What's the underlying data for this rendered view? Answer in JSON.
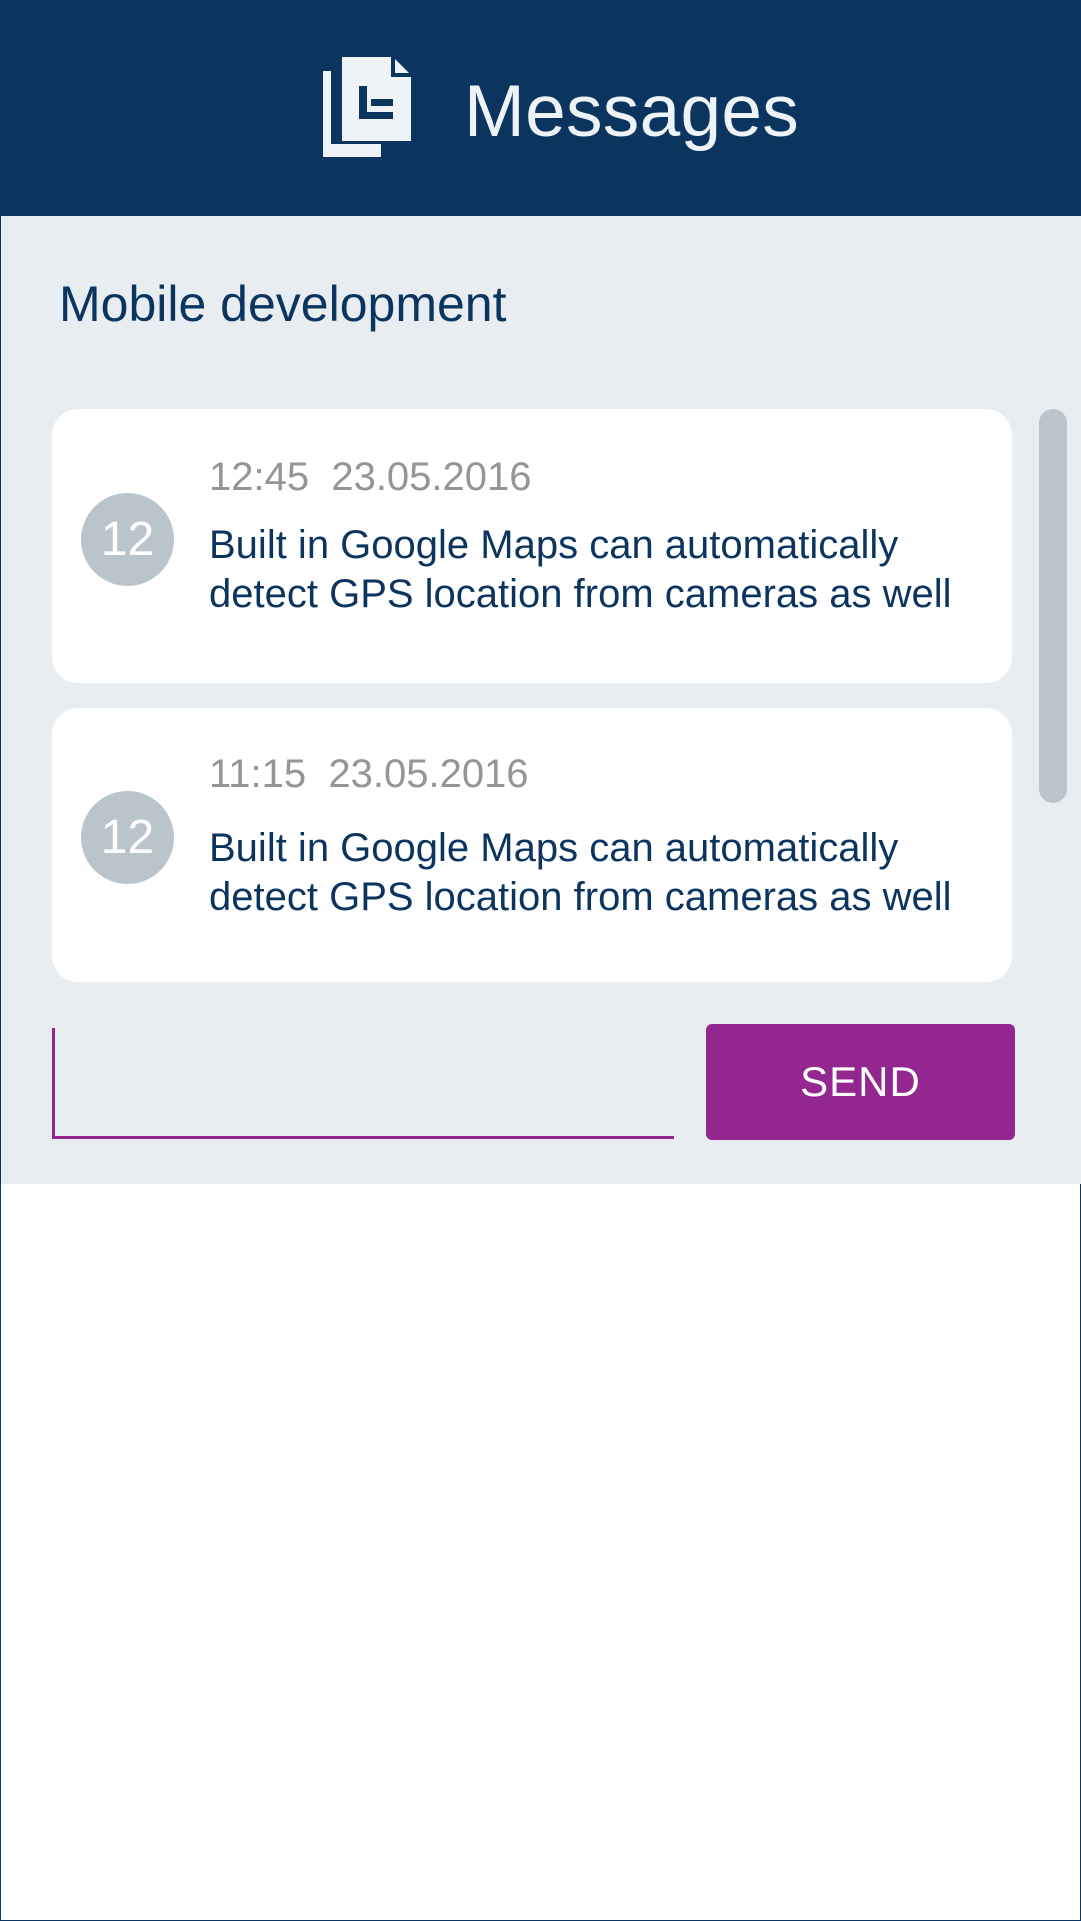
{
  "header": {
    "title": "Messages",
    "icon": "documents-icon",
    "background": "#0b355f"
  },
  "channel": {
    "title": "Mobile development"
  },
  "messages": [
    {
      "avatar_label": "12",
      "meta": "12:45  23.05.2016",
      "text": "Built in Google Maps can automatically detect GPS location from cameras as well"
    },
    {
      "avatar_label": "12",
      "meta": "11:15  23.05.2016",
      "text": "Built in Google Maps can automatically detect GPS location from cameras as well"
    }
  ],
  "composer": {
    "value": "",
    "send_label": "SEND",
    "accent": "#93278f"
  }
}
